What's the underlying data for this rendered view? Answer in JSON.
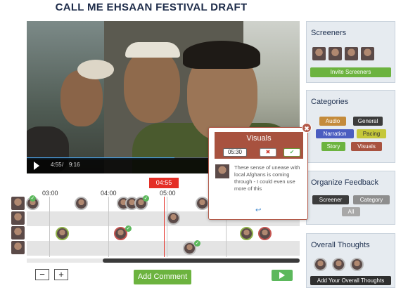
{
  "title": "CALL ME EHSAAN FESTIVAL DRAFT",
  "player": {
    "current": "4:55",
    "duration": "9:16",
    "progress": 0.54
  },
  "timeline": {
    "current_badge": "04:55",
    "ticks": [
      "03:00",
      "04:00",
      "05:00"
    ],
    "zoom_out": "−",
    "zoom_in": "+"
  },
  "actions": {
    "add_comment": "Add Comment"
  },
  "screeners": {
    "title": "Screeners",
    "invite": "Invite Screeners"
  },
  "categories": {
    "title": "Categories",
    "tags": [
      {
        "label": "Audio",
        "color": "#c48b3b"
      },
      {
        "label": "General",
        "color": "#3c3c3c"
      },
      {
        "label": "Narration",
        "color": "#4a5dc0"
      },
      {
        "label": "Pacing",
        "color": "#c5c73a"
      },
      {
        "label": "Story",
        "color": "#6cb33f"
      },
      {
        "label": "Visuals",
        "color": "#a8523f"
      }
    ]
  },
  "organize": {
    "title": "Organize Feedback",
    "screener": "Screener",
    "category": "Category",
    "all": "All"
  },
  "overall": {
    "title": "Overall Thoughts",
    "button": "Add Your Overall Thoughts"
  },
  "popup": {
    "category": "Visuals",
    "time": "05:30",
    "delete_icon": "✖",
    "confirm_icon": "✔",
    "text": "These sense of unease with local Afghans is coming through - I could even use more of this",
    "reply_icon": "↩",
    "close_icon": "✖"
  },
  "colors": {
    "accent_green": "#6cb33f",
    "red": "#e42f26",
    "panel": "#e6ebf0"
  }
}
